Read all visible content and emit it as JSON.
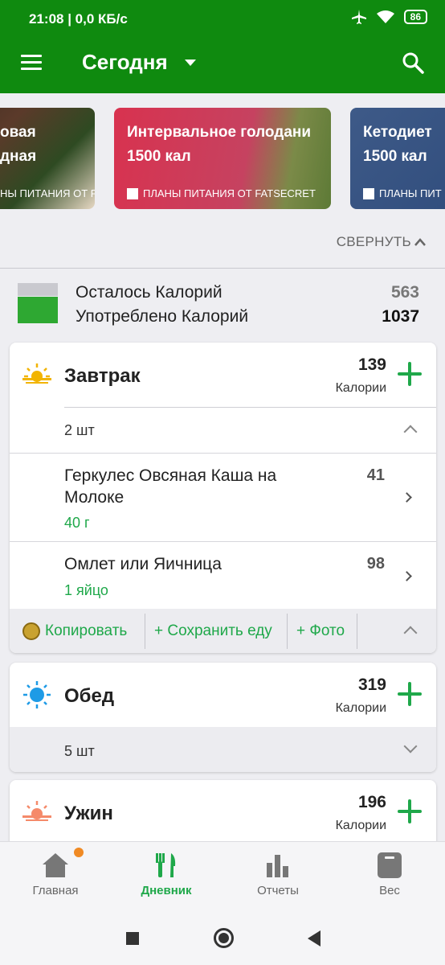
{
  "status_bar": {
    "time": "21:08 | 0,0 КБ/с",
    "battery": "86"
  },
  "app_bar": {
    "title": "Сегодня"
  },
  "carousel": [
    {
      "title_line1": "овая",
      "title_line2": "дная",
      "subtitle": "НЫ ПИТАНИЯ ОТ FATSECRET"
    },
    {
      "title_line1": "Интервальное голодани",
      "title_line2": "1500 кал",
      "subtitle": "ПЛАНЫ ПИТАНИЯ ОТ FATSECRET"
    },
    {
      "title_line1": "Кетодиет",
      "title_line2": "1500 кал",
      "subtitle": "ПЛАНЫ ПИТ"
    }
  ],
  "collapse_label": "СВЕРНУТЬ",
  "summary": {
    "remaining_label": "Осталось Калорий",
    "remaining_value": "563",
    "consumed_label": "Употреблено Калорий",
    "consumed_value": "1037"
  },
  "meals": {
    "breakfast": {
      "name": "Завтрак",
      "kcal": "139",
      "kcal_label": "Калории",
      "count": "2 шт",
      "items": [
        {
          "name": "Геркулес Овсяная Каша на Молоке",
          "qty": "40 г",
          "kcal": "41"
        },
        {
          "name": "Омлет или Яичница",
          "qty": "1 яйцо",
          "kcal": "98"
        }
      ],
      "actions": {
        "copy": "Копировать",
        "save": "+ Сохранить еду",
        "photo": "+ Фото"
      }
    },
    "lunch": {
      "name": "Обед",
      "kcal": "319",
      "kcal_label": "Калории",
      "count": "5 шт"
    },
    "dinner": {
      "name": "Ужин",
      "kcal": "196",
      "kcal_label": "Калории"
    }
  },
  "bottom_nav": [
    {
      "label": "Главная",
      "icon": "home-icon"
    },
    {
      "label": "Дневник",
      "icon": "fork-knife-icon"
    },
    {
      "label": "Отчеты",
      "icon": "bar-chart-icon"
    },
    {
      "label": "Вес",
      "icon": "scale-icon"
    }
  ],
  "colors": {
    "brand_green": "#0f8a0f",
    "accent_green": "#1fa84a",
    "badge_orange": "#f08a24"
  }
}
